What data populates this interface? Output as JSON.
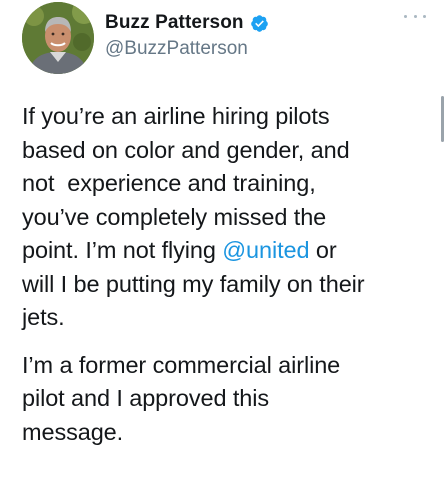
{
  "author": {
    "display_name": "Buzz Patterson",
    "handle": "@BuzzPatterson",
    "verified": true,
    "avatar_icon": "person-portrait-avatar"
  },
  "menu_icon": "more-dots-icon",
  "tweet": {
    "line_1": "If you’re an airline hiring pilots",
    "line_2": "based on color and gender, and",
    "line_3": "not  experience and training,",
    "line_4": "you’ve completely missed the",
    "line_5_pre": "point. I’m not flying ",
    "mention": "@united",
    "line_5_post": " or",
    "line_6": "will I be putting my family on their",
    "line_7": "jets.",
    "p2_line_1": "I’m a former commercial airline",
    "p2_line_2": "pilot and I approved this",
    "p2_line_3": "message."
  },
  "colors": {
    "text": "#14171a",
    "secondary": "#657786",
    "mention": "#1b95e0",
    "verified": "#1da1f2"
  }
}
